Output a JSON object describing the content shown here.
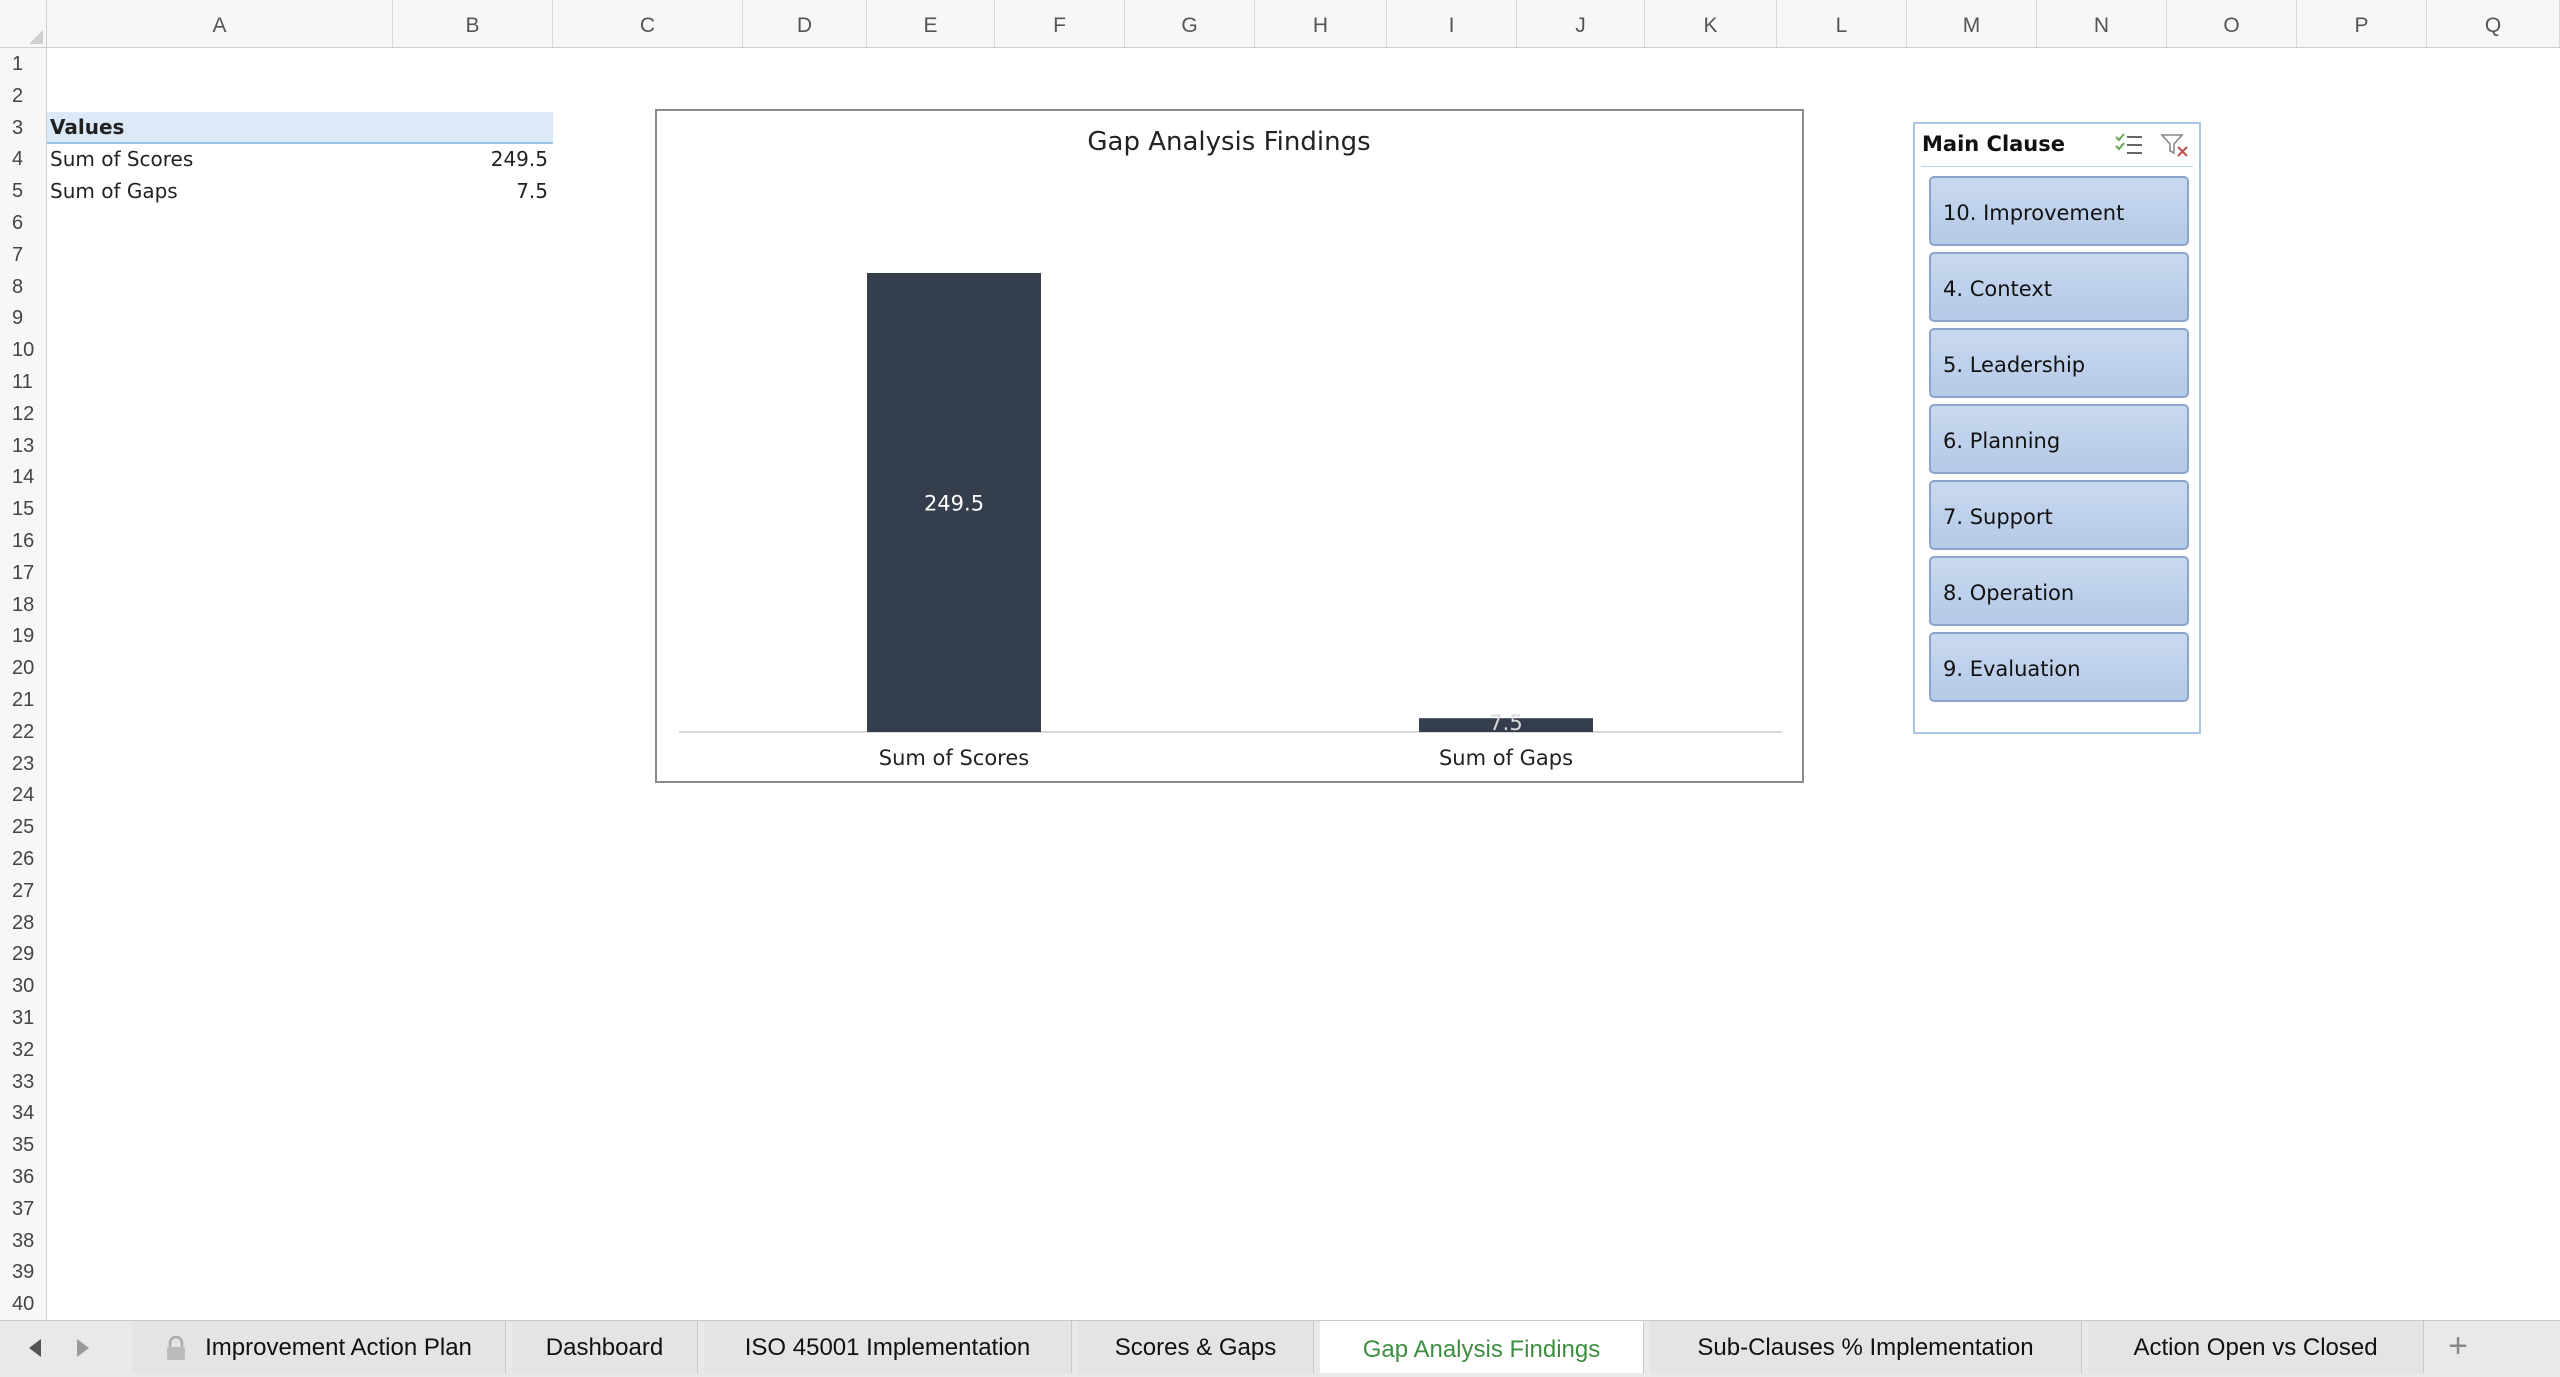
{
  "columns": [
    "A",
    "B",
    "C",
    "D",
    "E",
    "F",
    "G",
    "H",
    "I",
    "J",
    "K",
    "L",
    "M",
    "N",
    "O",
    "P",
    "Q"
  ],
  "rows": [
    "1",
    "2",
    "3",
    "4",
    "5",
    "6",
    "7",
    "8",
    "9",
    "10",
    "11",
    "12",
    "13",
    "14",
    "15",
    "16",
    "17",
    "18",
    "19",
    "20",
    "21",
    "22",
    "23",
    "24",
    "25",
    "26",
    "27",
    "28",
    "29",
    "30",
    "31",
    "32",
    "33",
    "34",
    "35",
    "36",
    "37",
    "38",
    "39",
    "40"
  ],
  "pivot": {
    "header": "Values",
    "rows": [
      {
        "label": "Sum of Scores",
        "value": "249.5"
      },
      {
        "label": "Sum of Gaps",
        "value": "7.5"
      }
    ]
  },
  "chart_data": {
    "type": "bar",
    "title": "Gap Analysis Findings",
    "categories": [
      "Sum of Scores",
      "Sum of Gaps"
    ],
    "values": [
      249.5,
      7.5
    ],
    "data_labels": [
      "249.5",
      "7.5"
    ],
    "ylim": [
      0,
      300
    ],
    "bar_color": "#353e4c",
    "grid": false,
    "legend": "none"
  },
  "slicer": {
    "title": "Main Clause",
    "icons": [
      "multi-select-icon",
      "clear-filter-icon"
    ],
    "items": [
      "10. Improvement",
      "4. Context",
      "5. Leadership",
      "6. Planning",
      "7. Support",
      "8. Operation",
      "9. Evaluation"
    ],
    "accent": "#a9c4e6"
  },
  "tabs": [
    {
      "label": "Improvement Action Plan",
      "locked": true
    },
    {
      "label": "Dashboard"
    },
    {
      "label": "ISO 45001 Implementation"
    },
    {
      "label": "Scores & Gaps"
    },
    {
      "label": "Gap Analysis Findings",
      "active": true
    },
    {
      "label": "Sub-Clauses % Implementation"
    },
    {
      "label": "Action Open vs Closed"
    }
  ],
  "active_tab_color": "#3e8e41"
}
